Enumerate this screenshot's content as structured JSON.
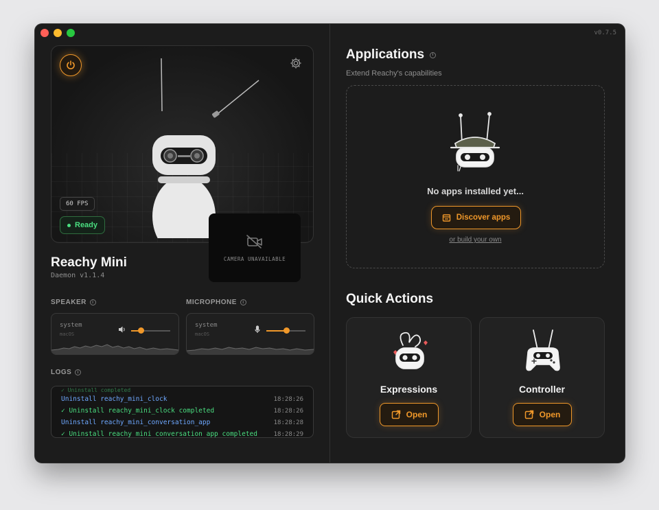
{
  "window": {
    "version": "v0.7.5"
  },
  "viewer": {
    "fps": "60 FPS",
    "status": "Ready",
    "camera_text": "CAMERA UNAVAILABLE"
  },
  "robot": {
    "name": "Reachy Mini",
    "daemon": "Daemon v1.1.4"
  },
  "speaker": {
    "label": "SPEAKER",
    "device": "system",
    "sub": "macOS",
    "volume": 0.25
  },
  "microphone": {
    "label": "MICROPHONE",
    "device": "system",
    "sub": "macOS",
    "volume": 0.5
  },
  "logs": {
    "label": "LOGS",
    "partial": "✓ Uninstall completed",
    "rows": [
      {
        "text": "Uninstall reachy_mini_clock",
        "time": "18:28:26",
        "kind": "blue"
      },
      {
        "text": "✓ Uninstall reachy_mini_clock completed",
        "time": "18:28:26",
        "kind": "green"
      },
      {
        "text": "Uninstall reachy_mini_conversation_app",
        "time": "18:28:28",
        "kind": "blue"
      },
      {
        "text": "✓ Uninstall reachy_mini_conversation_app completed",
        "time": "18:28:29",
        "kind": "green"
      }
    ]
  },
  "applications": {
    "title": "Applications",
    "subtitle": "Extend Reachy's capabilities",
    "empty_text": "No apps installed yet...",
    "discover_label": "Discover apps",
    "build_link": "or build your own"
  },
  "quick_actions": {
    "title": "Quick Actions",
    "cards": [
      {
        "label": "Expressions",
        "button": "Open"
      },
      {
        "label": "Controller",
        "button": "Open"
      }
    ]
  },
  "colors": {
    "accent": "#f0982a",
    "ready": "#4ade80",
    "log_blue": "#6ea8ff"
  }
}
